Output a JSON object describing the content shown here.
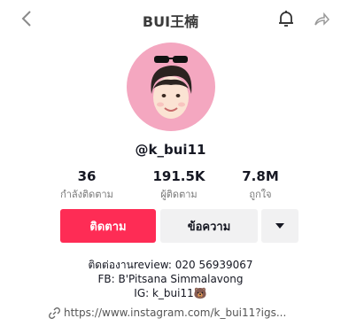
{
  "header": {
    "title": "BUI王楠"
  },
  "profile": {
    "username": "@k_bui11",
    "stats": [
      {
        "value": "36",
        "label": "กำลังติดตาม"
      },
      {
        "value": "191.5K",
        "label": "ผู้ติดตาม"
      },
      {
        "value": "7.8M",
        "label": "ถูกใจ"
      }
    ],
    "follow_label": "ติดตาม",
    "message_label": "ข้อความ",
    "bio_lines": [
      "ติดต่องานreview: 020 56939067",
      "FB: B'Pitsana Simmalavong",
      "IG: k_bui11🐻"
    ],
    "link": "https://www.instagram.com/k_bui11?igs..."
  },
  "colors": {
    "accent": "#fe2c55",
    "avatar_bg": "#f4a7c0"
  },
  "icons": [
    "back-icon",
    "bell-icon",
    "share-icon",
    "chevron-down-icon",
    "link-icon"
  ]
}
